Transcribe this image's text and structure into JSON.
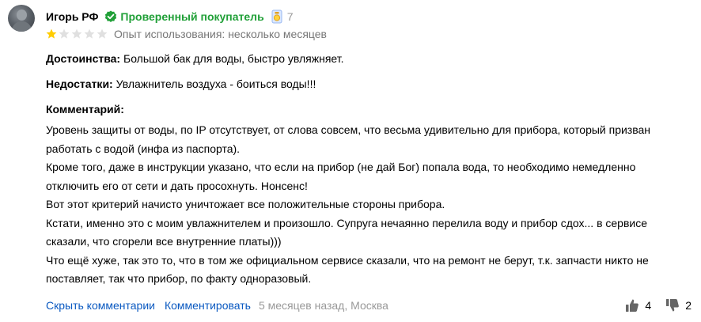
{
  "review": {
    "author": "Игорь РФ",
    "verified_label": "Проверенный покупатель",
    "review_count": "7",
    "rating": 1,
    "rating_max": 5,
    "experience": "Опыт использования: несколько месяцев",
    "pros_label": "Достоинства:",
    "pros_text": "Большой бак для воды, быстро увляжняет.",
    "cons_label": "Недостатки:",
    "cons_text": "Увлажнитель воздуха - боиться воды!!!",
    "comment_label": "Комментарий:",
    "comment_lines": [
      "Уровень защиты от воды, по IP отсутствует, от слова совсем, что весьма удивительно для прибора, который призван",
      "работать с водой (инфа из паспорта).",
      "Кроме того, даже в инструкции указано, что если на прибор (не дай Бог) попала вода, то необходимо немедленно",
      "отключить его от сети и дать просохнуть. Нонсенс!",
      "Вот этот критерий начисто уничтожает все положительные стороны прибора.",
      "Кстати, именно это с моим увлажнителем и произошло. Супруга нечаянно перелила воду и прибор сдох... в сервисе",
      "сказали, что сгорели все внутренние платы)))",
      "Что ещё хуже, так это то, что в том же официальном сервисе сказали, что на ремонт не берут, т.к. запчасти никто не",
      "поставляет, так что прибор, по факту одноразовый."
    ]
  },
  "footer": {
    "hide_comments": "Скрыть комментарии",
    "comment_action": "Комментировать",
    "meta": "5 месяцев назад, Москва",
    "likes": "4",
    "dislikes": "2"
  },
  "colors": {
    "verified": "#21a038",
    "link": "#0a59c1",
    "star_filled": "#fc0",
    "star_empty": "#e0e0e0",
    "muted": "#999999"
  },
  "icons": [
    "avatar",
    "verified-check-icon",
    "medal-icon",
    "star-icon",
    "thumbs-up-icon",
    "thumbs-down-icon"
  ]
}
